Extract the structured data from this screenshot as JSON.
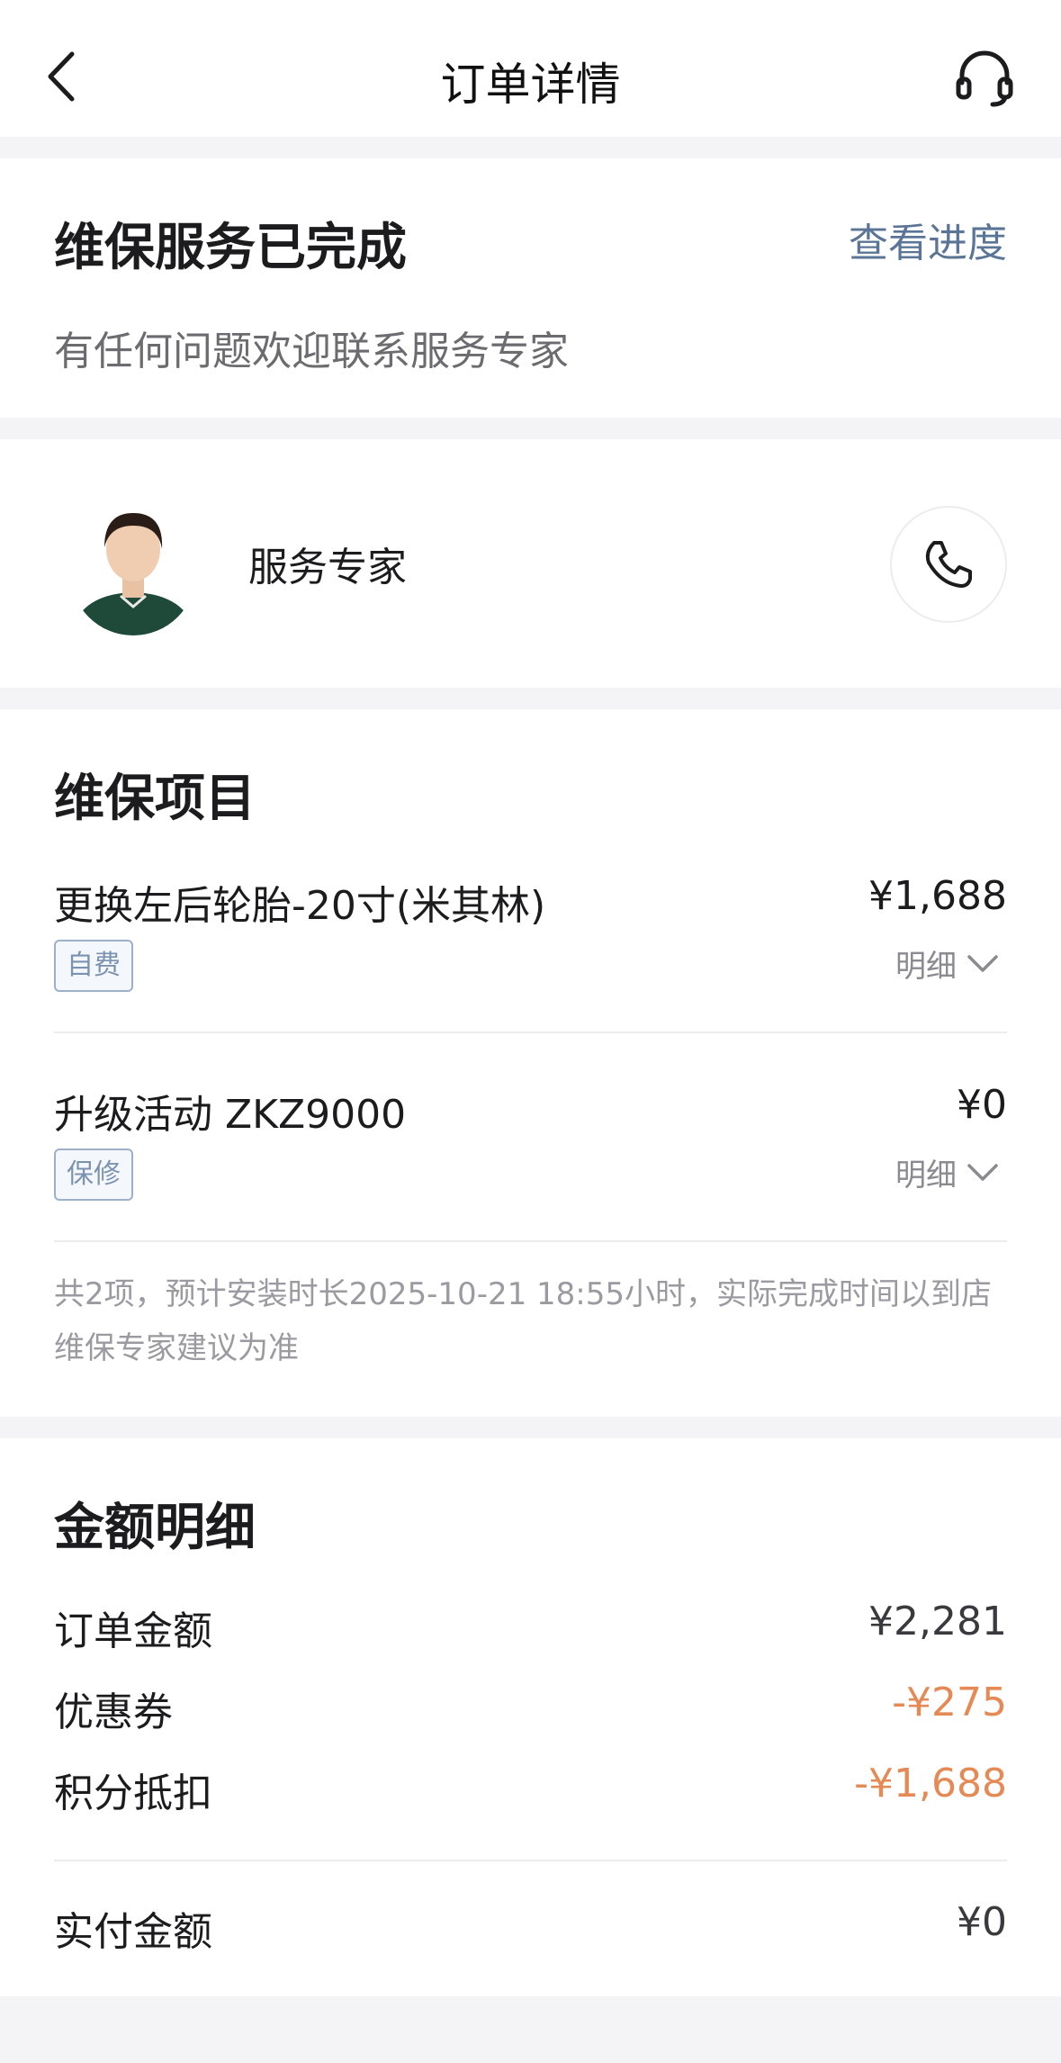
{
  "header": {
    "title": "订单详情",
    "back_icon": "chevron-left-icon",
    "support_icon": "headset-icon"
  },
  "status": {
    "title": "维保服务已完成",
    "progress_link": "查看进度",
    "subtitle": "有任何问题欢迎联系服务专家"
  },
  "expert": {
    "label": "服务专家",
    "phone_icon": "phone-icon"
  },
  "maintenance": {
    "title": "维保项目",
    "items": [
      {
        "name": "更换左后轮胎-20寸(米其林)",
        "price": "¥1,688",
        "tag": "自费",
        "detail_label": "明细"
      },
      {
        "name": "升级活动 ZKZ9000",
        "price": "¥0",
        "tag": "保修",
        "detail_label": "明细"
      }
    ],
    "note": "共2项，预计安装时长2025-10-21 18:55小时，实际完成时间以到店维保专家建议为准"
  },
  "amount": {
    "title": "金额明细",
    "rows": [
      {
        "label": "订单金额",
        "value": "¥2,281"
      },
      {
        "label": "优惠券",
        "value": "-¥275"
      },
      {
        "label": "积分抵扣",
        "value": "-¥1,688"
      }
    ],
    "total": {
      "label": "实付金额",
      "value": "¥0"
    }
  },
  "colors": {
    "link": "#5b7596",
    "discount": "#e58a54",
    "tag_border": "#9db0c8"
  }
}
